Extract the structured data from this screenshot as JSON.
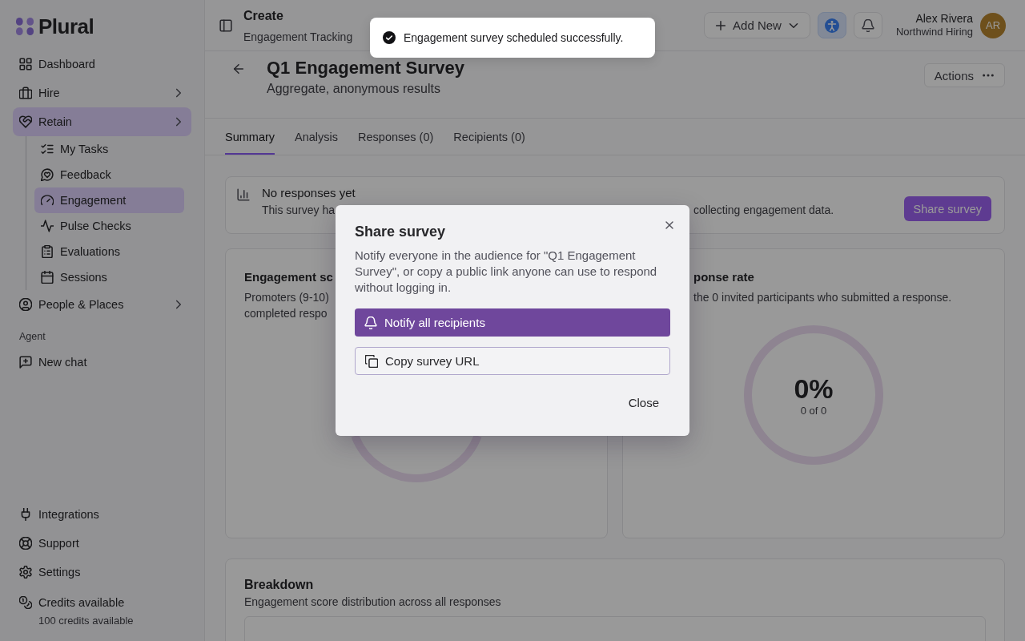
{
  "sidebar": {
    "logo": "Plural",
    "nav": [
      {
        "label": "Dashboard",
        "kind": "link",
        "selected": false
      },
      {
        "label": "Hire",
        "kind": "group",
        "selected": false
      },
      {
        "label": "Retain",
        "kind": "group",
        "selected": true,
        "children": [
          {
            "label": "My Tasks",
            "selected": false
          },
          {
            "label": "Feedback",
            "selected": false
          },
          {
            "label": "Engagement",
            "selected": true
          },
          {
            "label": "Pulse Checks",
            "selected": false
          },
          {
            "label": "Evaluations",
            "selected": false
          },
          {
            "label": "Sessions",
            "selected": false
          }
        ]
      },
      {
        "label": "People & Places",
        "kind": "group",
        "selected": false
      }
    ],
    "sections": [
      {
        "heading": "Agent",
        "items": [
          {
            "label": "New chat",
            "selected": false
          }
        ]
      }
    ],
    "footer": [
      {
        "label": "Integrations",
        "selected": false
      },
      {
        "label": "Support",
        "selected": false
      },
      {
        "label": "Settings",
        "selected": false
      }
    ],
    "credits": {
      "title": "Credits available",
      "detail": "100 credits available"
    }
  },
  "header": {
    "title": "Create",
    "subtitle": "Engagement Tracking",
    "add_button": "Add New",
    "toggle_button": {
      "on": true
    },
    "user": {
      "name": "Alex Rivera",
      "org": "Northwind Hiring",
      "initials": "AR"
    }
  },
  "page": {
    "title": "Q1 Engagement Survey",
    "subtitle": "Aggregate, anonymous results",
    "actions_button": "Actions"
  },
  "tabs": [
    {
      "label": "Summary",
      "selected": true
    },
    {
      "label": "Analysis",
      "selected": false
    },
    {
      "label": "Responses (0)",
      "selected": false
    },
    {
      "label": "Recipients (0)",
      "selected": false
    }
  ],
  "banner": {
    "title": "No responses yet",
    "text_start": "This survey ha",
    "text_end": "collecting engagement data.",
    "button": "Share survey"
  },
  "cards": [
    {
      "kind": "covered",
      "title": "Engagement sc",
      "description": [
        "Promoters (9-10)",
        "completed respo"
      ]
    },
    {
      "kind": "donut",
      "title": "ponse rate",
      "description": [
        "the 0 invited participants who submitted a response."
      ],
      "value": "0%",
      "count": "0 of 0"
    }
  ],
  "breakdown": {
    "title": "Breakdown",
    "subtitle": "Engagement score distribution across all responses"
  },
  "toast": {
    "message": "Engagement survey scheduled successfully."
  },
  "dialog": {
    "title": "Share survey",
    "text": "Notify everyone in the audience for \"Q1 Engagement Survey\", or copy a public link anyone can use to respond without logging in.",
    "actions": [
      {
        "label": "Notify all recipients",
        "kind": "primary"
      },
      {
        "label": "Copy survey URL",
        "kind": "outline"
      }
    ],
    "close_button": "Close"
  }
}
